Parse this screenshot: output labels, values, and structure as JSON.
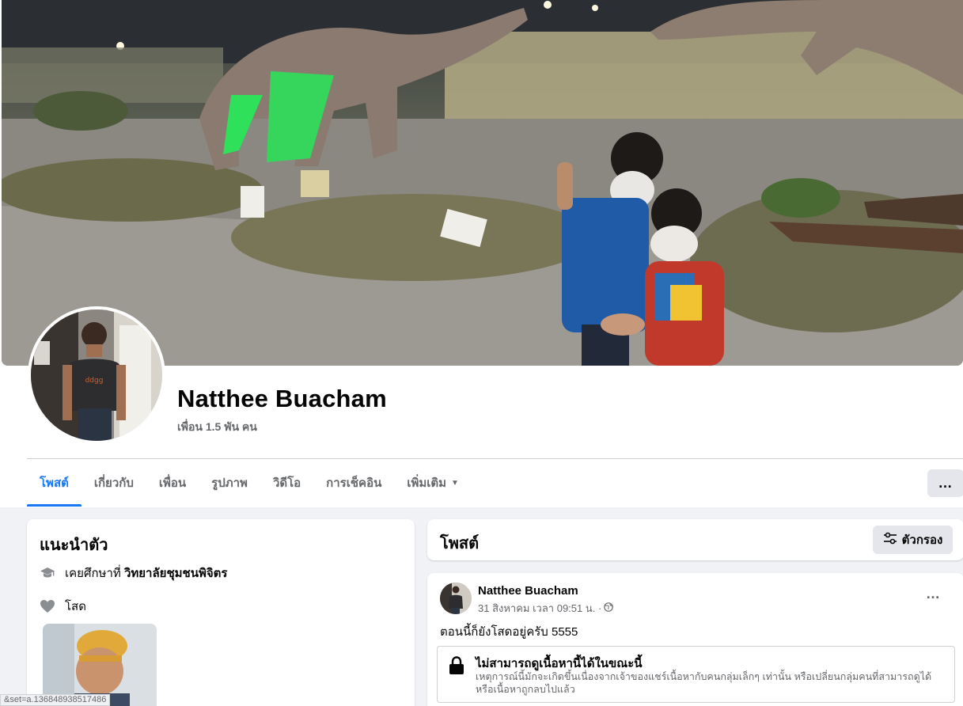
{
  "profile": {
    "name": "Natthee Buacham",
    "friends": "เพื่อน 1.5 พัน คน"
  },
  "tabs": {
    "items": [
      {
        "label": "โพสต์"
      },
      {
        "label": "เกี่ยวกับ"
      },
      {
        "label": "เพื่อน"
      },
      {
        "label": "รูปภาพ"
      },
      {
        "label": "วิดีโอ"
      },
      {
        "label": "การเช็คอิน"
      },
      {
        "label": "เพิ่มเติม"
      }
    ],
    "more_icon": "…"
  },
  "intro": {
    "title": "แนะนำตัว",
    "education_prefix": "เคยศึกษาที่",
    "education_school": "วิทยาลัยชุมชนพิจิตร",
    "relationship": "โสด"
  },
  "posts": {
    "title": "โพสต์",
    "filter_label": "ตัวกรอง"
  },
  "post": {
    "author": "Natthee Buacham",
    "meta": "31 สิงหาคม เวลา 09:51 น. ·",
    "text": "ตอนนี้ก็ยังโสดอยู่ครับ 5555",
    "unavailable_title": "ไม่สามารถดูเนื้อหานี้ได้ในขณะนี้",
    "unavailable_desc": "เหตุการณ์นี้มักจะเกิดขึ้นเนื่องจากเจ้าของแชร์เนื้อหากับคนกลุ่มเล็กๆ เท่านั้น หรือเปลี่ยนกลุ่มคนที่สามารถดูได้ หรือเนื้อหาถูกลบไปแล้ว",
    "menu_icon": "…"
  },
  "status_url": "&set=a.136848938517486",
  "icons": {
    "education": "graduation-cap-icon",
    "relationship": "heart-icon",
    "filter": "sliders-icon",
    "privacy": "globe-icon",
    "lock": "lock-icon"
  },
  "colors": {
    "accent": "#1877f2",
    "background": "#f0f2f5",
    "secondary_text": "#65676b",
    "button_gray": "#e4e6eb"
  }
}
